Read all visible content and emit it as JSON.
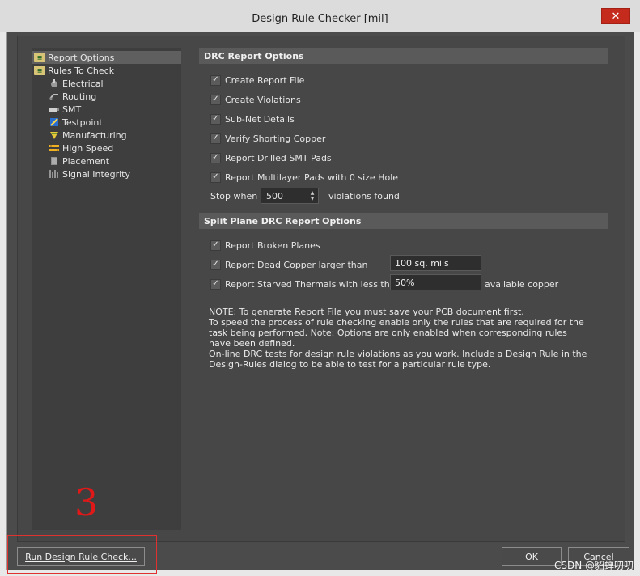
{
  "window": {
    "title": "Design Rule Checker [mil]",
    "close_glyph": "✕"
  },
  "tree": {
    "items": [
      {
        "label": "Report Options",
        "icon": "folder-icon"
      },
      {
        "label": "Rules To Check",
        "icon": "folder-icon"
      },
      {
        "label": "Electrical",
        "icon": "electrical-icon"
      },
      {
        "label": "Routing",
        "icon": "routing-icon"
      },
      {
        "label": "SMT",
        "icon": "smt-icon"
      },
      {
        "label": "Testpoint",
        "icon": "testpoint-icon"
      },
      {
        "label": "Manufacturing",
        "icon": "manufacturing-icon"
      },
      {
        "label": "High Speed",
        "icon": "high-speed-icon"
      },
      {
        "label": "Placement",
        "icon": "placement-icon"
      },
      {
        "label": "Signal Integrity",
        "icon": "signal-integrity-icon"
      }
    ]
  },
  "drc_report": {
    "header": "DRC Report Options",
    "options": [
      {
        "label": "Create Report File",
        "checked": true
      },
      {
        "label": "Create Violations",
        "checked": true
      },
      {
        "label": "Sub-Net Details",
        "checked": true
      },
      {
        "label": "Verify Shorting Copper",
        "checked": true
      },
      {
        "label": "Report Drilled SMT Pads",
        "checked": true
      },
      {
        "label": "Report Multilayer Pads with 0 size Hole",
        "checked": true
      }
    ],
    "stop_when_label": "Stop when",
    "stop_when_value": "500",
    "violations_found_label": "violations found"
  },
  "split_plane": {
    "header": "Split Plane DRC Report Options",
    "options": [
      {
        "label": "Report Broken Planes",
        "checked": true
      },
      {
        "label": "Report Dead Copper larger than",
        "checked": true,
        "value": "100 sq. mils"
      },
      {
        "label": "Report Starved Thermals with less than",
        "checked": true,
        "value": "50%",
        "suffix": "available copper"
      }
    ]
  },
  "note": {
    "lines": [
      "NOTE: To generate Report File you must save your PCB document first.",
      "To speed the process of rule checking enable only the rules that are required for the task being performed.  Note: Options are only enabled when corresponding rules have been defined.",
      "On-line DRC tests for design rule violations as you work. Include a Design Rule in the Design-Rules dialog to be able to test for a particular rule  type."
    ]
  },
  "buttons": {
    "run_label": "Run Design Rule Check...",
    "ok_label": "OK",
    "cancel_label": "Cancel"
  },
  "annotation": {
    "number": "3",
    "color": "#e01818"
  },
  "watermark": "CSDN @貂蝉叨叨",
  "check_glyph": "✓"
}
